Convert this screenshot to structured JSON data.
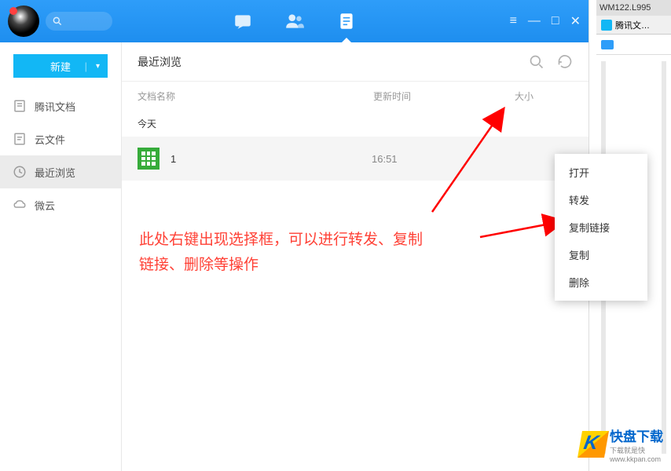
{
  "titlebar": {
    "search_placeholder": ""
  },
  "sidebar": {
    "new_button": "新建",
    "items": [
      {
        "label": "腾讯文档",
        "icon": "doc-icon"
      },
      {
        "label": "云文件",
        "icon": "cloud-file-icon"
      },
      {
        "label": "最近浏览",
        "icon": "recent-icon",
        "active": true
      },
      {
        "label": "微云",
        "icon": "weiyun-icon"
      }
    ]
  },
  "content": {
    "header_title": "最近浏览",
    "columns": {
      "name": "文档名称",
      "time": "更新时间",
      "size": "大小"
    },
    "date_group": "今天",
    "files": [
      {
        "name": "1",
        "time": "16:51"
      }
    ]
  },
  "context_menu": {
    "items": [
      "打开",
      "转发",
      "复制链接",
      "复制",
      "删除"
    ]
  },
  "annotation": {
    "line1": "此处右键出现选择框，可以进行转发、复制",
    "line2": "链接、删除等操作"
  },
  "watermark": {
    "brand": "快盘下载",
    "slogan": "下载就是快",
    "url": "www.kkpan.com"
  },
  "right_strip": {
    "title": "WM122.L995",
    "tab": "腾讯文…"
  }
}
